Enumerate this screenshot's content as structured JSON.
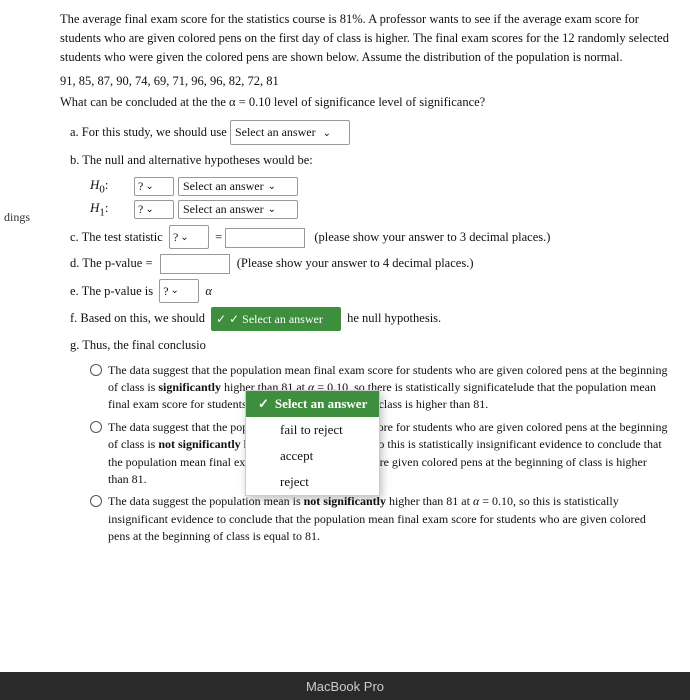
{
  "problem": {
    "intro": "The average final exam score for the statistics course is 81%. A professor wants to see if the average exam score for students who are given colored pens on the first day of class is higher. The final exam scores for the 12 randomly selected students who were given the colored pens are shown below. Assume the distribution of the population is normal.",
    "data": "91, 85, 87, 90, 74, 69, 71, 96, 96, 82, 72, 81",
    "question": "What can be concluded at the the α = 0.10 level of significance level of significance?",
    "part_a_label": "a. For this study, we should use",
    "part_a_select": "Select an answer",
    "part_b_label": "b. The null and alternative hypotheses would be:",
    "h0_label": "H₀:",
    "h1_label": "H₁:",
    "h0_symbol_select": "?",
    "h1_symbol_select": "?",
    "h0_answer_select": "Select an answer",
    "h1_answer_select": "Select an answer",
    "part_c_label": "c. The test statistic",
    "part_c_select": "?",
    "part_c_note": "(please show your answer to 3 decimal places.)",
    "part_d_label": "d. The p-value =",
    "part_d_note": "(Please show your answer to 4 decimal places.)",
    "part_e_label": "e. The p-value is",
    "part_e_select": "?",
    "part_e_alpha": "α",
    "part_f_label": "f. Based on this, we should",
    "part_f_select_text": "✓ Select an answer",
    "part_f_note": "he null hypothesis.",
    "part_g_label": "g. Thus, the final conclusio",
    "radio_options": [
      "The data suggest that the population mean final exam score for students who are given colored pens at the beginning of class is significantly higher than 81 at α = 0.10, so there is statistically significant evidence to conclude that the population mean final exam score for students who are given colored pens at the beginning of class is higher than 81.",
      "The data suggest that the population mean final exam score for students who are given colored pens at the beginning of class is not significantly higher than 81 at α = 0.10, so this is statistically insignificant evidence to conclude that the population mean final exam score for students who are given colored pens at the beginning of class is higher than 81.",
      "The data suggest the population mean is not significantly higher than 81 at α = 0.10, so this is statistically insignificant evidence to conclude that the population mean final exam score for students who are given colored pens at the beginning of class is equal to 81."
    ],
    "dropdown_items": [
      {
        "label": "Select an answer",
        "selected": true
      },
      {
        "label": "fail to reject",
        "selected": false
      },
      {
        "label": "accept",
        "selected": false
      },
      {
        "label": "reject",
        "selected": false
      }
    ]
  },
  "left_margin": "dings",
  "bottom_bar": "MacBook Pro"
}
